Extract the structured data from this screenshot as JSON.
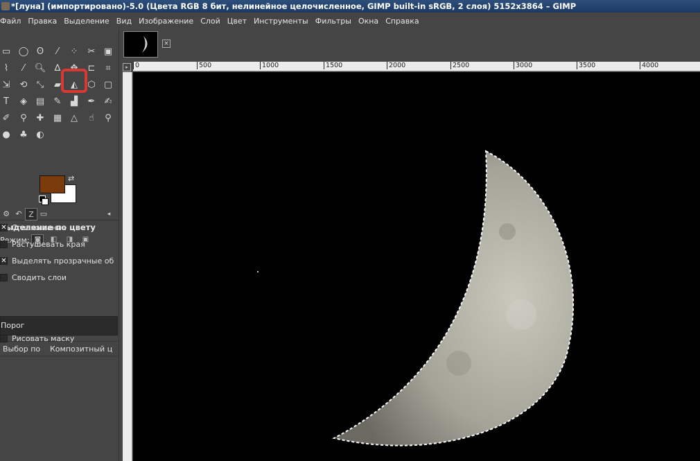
{
  "window": {
    "title": "*[луна] (импортировано)-5.0 (Цвета RGB 8 бит, нелинейное целочисленное, GIMP built-in sRGB, 2 слоя) 5152x3864 – GIMP"
  },
  "menu": [
    "Файл",
    "Правка",
    "Выделение",
    "Вид",
    "Изображение",
    "Слой",
    "Цвет",
    "Инструменты",
    "Фильтры",
    "Окна",
    "Справка"
  ],
  "colors": {
    "foreground": "#7a3a0a",
    "background": "#ffffff",
    "highlight": "#d83a33"
  },
  "tool_options": {
    "title": "Выделение по цвету",
    "mode_label": "Режим:",
    "antialias": {
      "label": "Сглаживание",
      "checked": true
    },
    "feather": {
      "label": "Растушевать края",
      "checked": false
    },
    "transparent": {
      "label": "Выделять прозрачные об",
      "checked": true
    },
    "merged": {
      "label": "Сводить слои",
      "checked": false
    },
    "threshold_label": "Порог",
    "select_by_label": "Выбор по",
    "select_by_value": "Композитный ц",
    "draw_mask": {
      "label": "Рисовать маску",
      "checked": false
    }
  },
  "ruler": {
    "h_ticks": [
      "0",
      "500",
      "1000",
      "1500",
      "2000",
      "2500",
      "3000",
      "3500",
      "4000"
    ]
  }
}
